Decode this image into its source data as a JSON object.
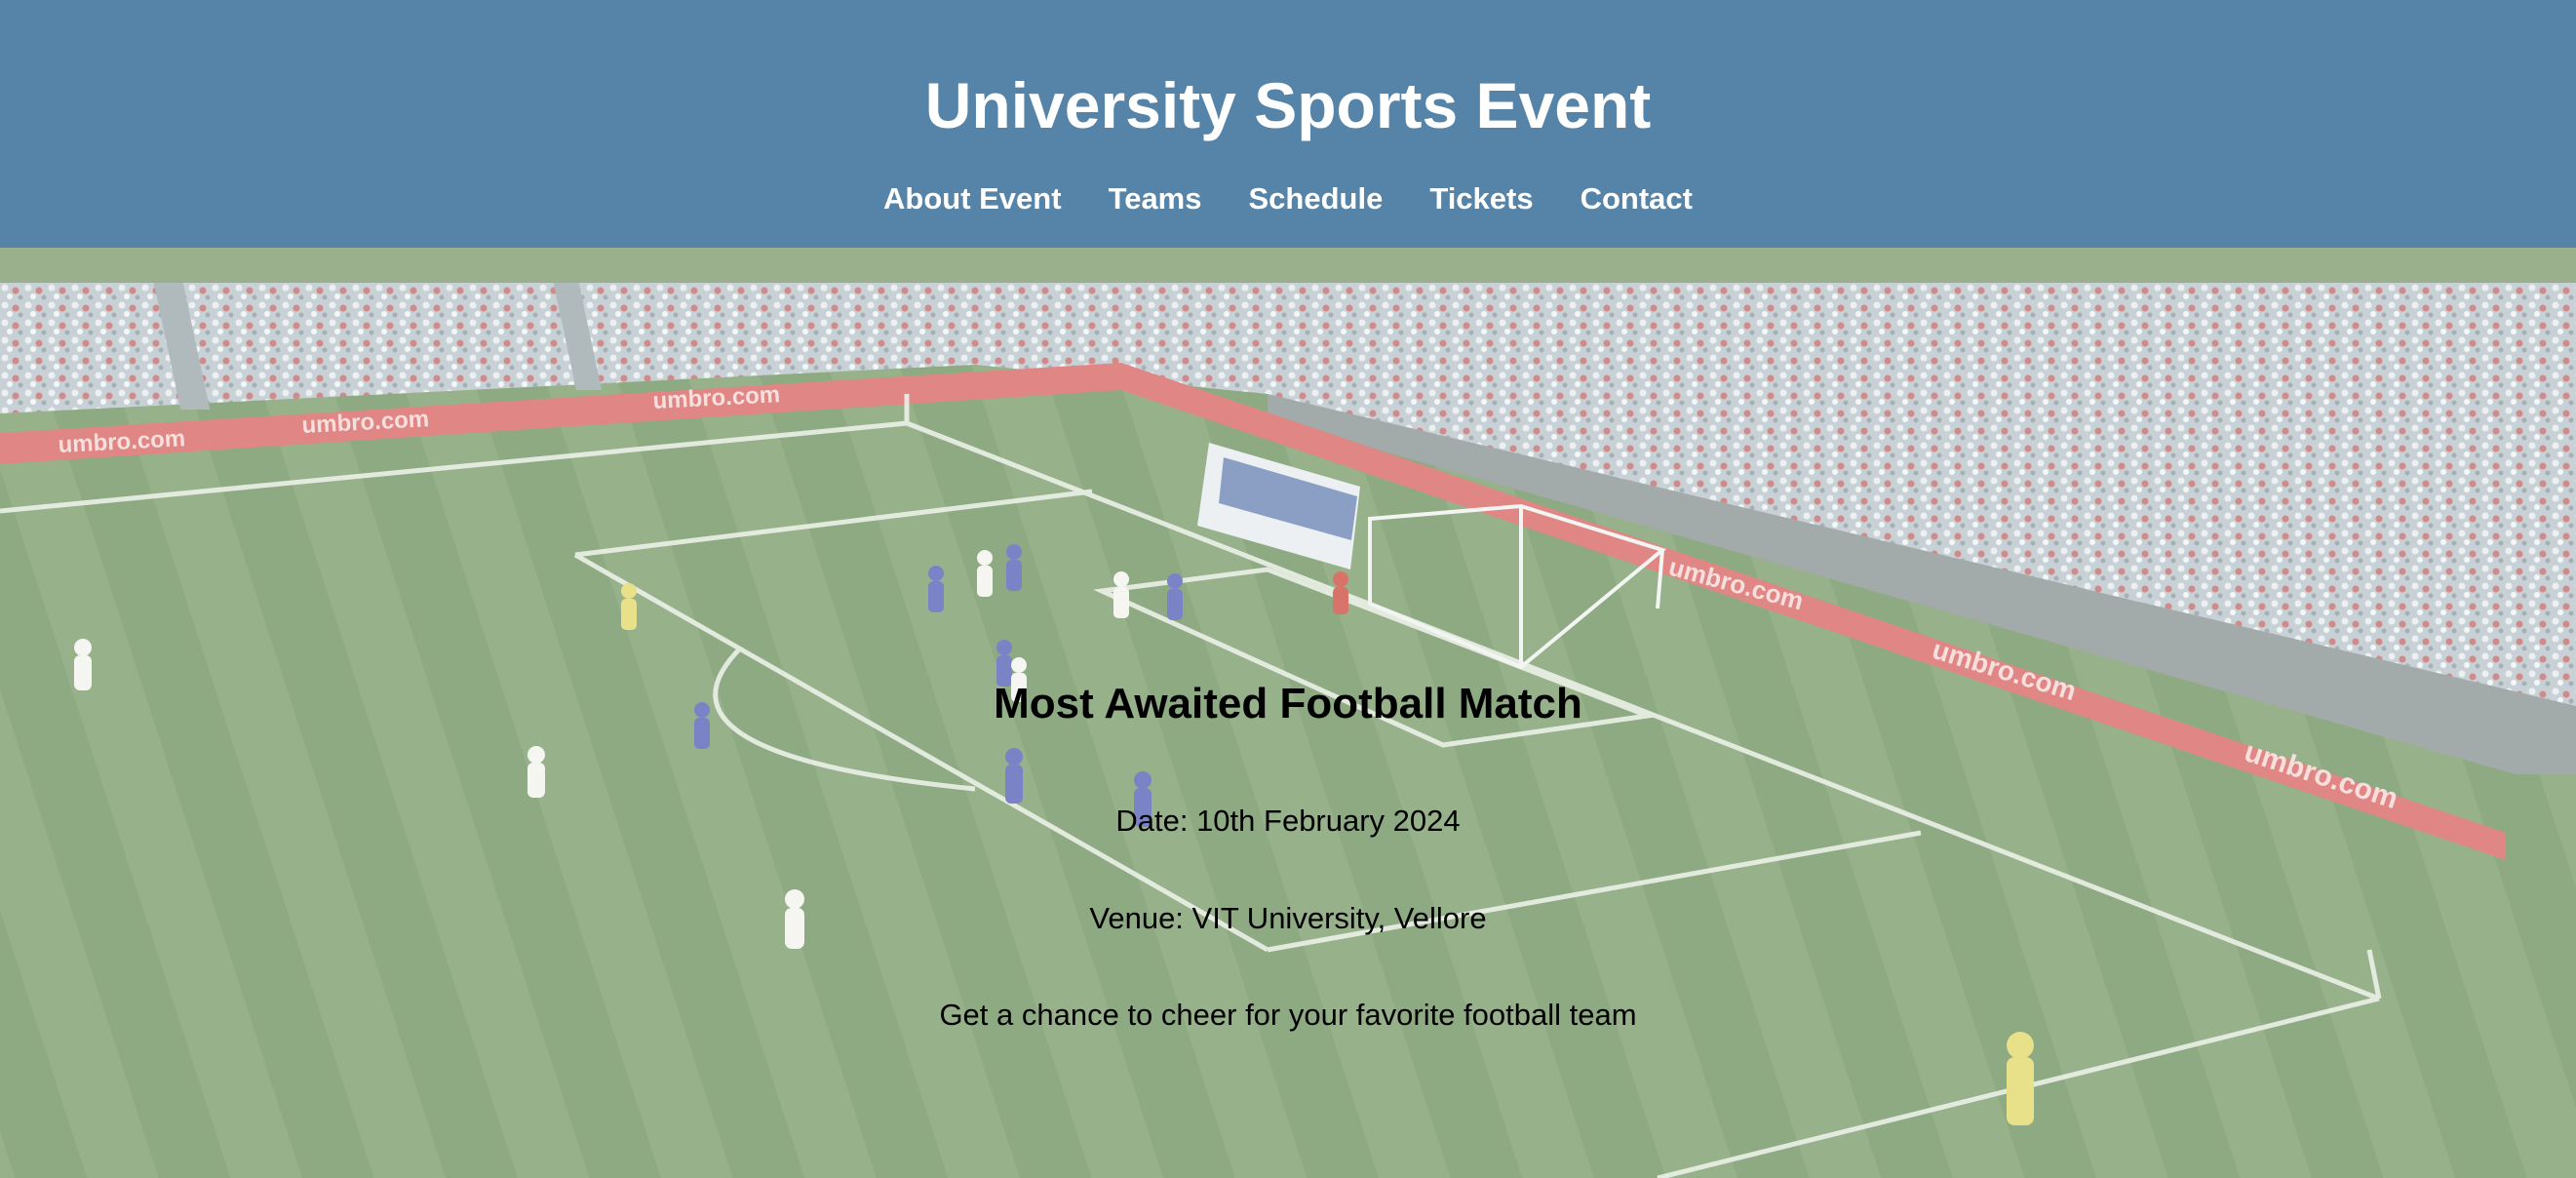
{
  "header": {
    "title": "University Sports Event",
    "nav": [
      {
        "label": "About Event"
      },
      {
        "label": "Teams"
      },
      {
        "label": "Schedule"
      },
      {
        "label": "Tickets"
      },
      {
        "label": "Contact"
      }
    ]
  },
  "hero": {
    "heading": "Most Awaited Football Match",
    "date": "Date: 10th February 2024",
    "venue": "Venue: VIT University, Vellore",
    "tagline": "Get a chance to cheer for your favorite football team",
    "background": "football-stadium-photo",
    "ad_board_text": "umbro.com"
  },
  "colors": {
    "header_bg": "#5684a8",
    "header_text": "#ffffff",
    "hero_text": "#000000"
  }
}
